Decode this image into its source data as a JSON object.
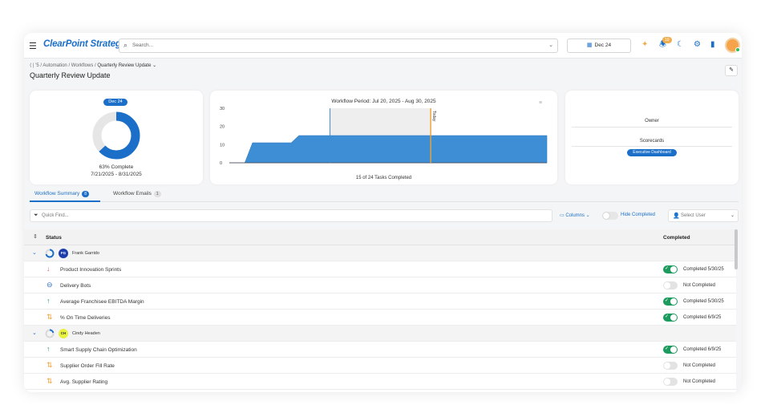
{
  "app": {
    "logo": "ClearPoint Strategy",
    "search_placeholder": "Search...",
    "date_button": "Dec 24",
    "notification_count": "10"
  },
  "breadcrumb": {
    "home": "⟨ |",
    "scorecard": "'5",
    "automation": "Automation",
    "workflows": "Workflows",
    "current": "Quarterly Review Update ⌄",
    "sep": "/"
  },
  "page": {
    "title": "Quarterly Review Update"
  },
  "summary": {
    "date_pill": "Dec 24",
    "percent_complete": 63,
    "percent_text": "63% Complete",
    "range": "7/21/2025 - 8/31/2025"
  },
  "chart_data": {
    "type": "area",
    "title": "Workflow Period: Jul 20, 2025 - Aug 30, 2025",
    "footer": "15 of 24 Tasks Completed",
    "y_ticks": [
      0,
      10,
      20,
      30
    ],
    "ylim": [
      0,
      30
    ],
    "x_range_days": [
      0,
      41
    ],
    "series": [
      {
        "x": [
          0,
          2,
          3,
          8,
          9,
          41
        ],
        "y": [
          0,
          0,
          11,
          11,
          15,
          15
        ]
      }
    ],
    "today_label": "Today",
    "today_day": 26,
    "period_marker_day": 13
  },
  "info": {
    "owner_label": "Owner",
    "scorecards_label": "Scorecards",
    "scorecard_pill": "Executive Dashboard"
  },
  "tabs": [
    {
      "label": "Workflow Summary",
      "count": "8"
    },
    {
      "label": "Workflow Emails",
      "count": "1"
    }
  ],
  "filters": {
    "quickfind_placeholder": "Quick Find...",
    "columns_label": "Columns ⌄",
    "hide_completed_label": "Hide Completed",
    "select_user_placeholder": "Select User"
  },
  "table": {
    "col_status": "Status",
    "col_completed": "Completed",
    "groups": [
      {
        "initials": "FG",
        "name": "Frank Garrido",
        "initials_bg": "#1d3fae",
        "initials_fg": "#ffffff",
        "rows": [
          {
            "icon": "↓",
            "icon_color": "#e35d6a",
            "label": "Product Innovation Sprints",
            "done": true,
            "completed": "Completed 5/30/25"
          },
          {
            "icon": "⊖",
            "icon_color": "#2f6fc0",
            "label": "Delivery Bots",
            "done": false,
            "completed": "Not Completed"
          },
          {
            "icon": "↑",
            "icon_color": "#1d9a5e",
            "label": "Average Franchisee EBITDA Margin",
            "done": true,
            "completed": "Completed 5/30/25"
          },
          {
            "icon": "⇅",
            "icon_color": "#f0a030",
            "label": "% On Time Deliveries",
            "done": true,
            "completed": "Completed 6/9/25"
          }
        ]
      },
      {
        "initials": "CH",
        "name": "Cindy Headen",
        "initials_bg": "#e7f23e",
        "initials_fg": "#333333",
        "rows": [
          {
            "icon": "↑",
            "icon_color": "#1d9a5e",
            "label": "Smart Supply Chain Optimization",
            "done": true,
            "completed": "Completed 6/9/25"
          },
          {
            "icon": "⇅",
            "icon_color": "#f0a030",
            "label": "Supplier Order Fill Rate",
            "done": false,
            "completed": "Not Completed"
          },
          {
            "icon": "⇅",
            "icon_color": "#f0a030",
            "label": "Avg. Supplier Rating",
            "done": false,
            "completed": "Not Completed"
          }
        ]
      }
    ]
  },
  "colors": {
    "accent": "#1b6fc9",
    "success": "#1d9a5e",
    "today": "#f0a030"
  }
}
